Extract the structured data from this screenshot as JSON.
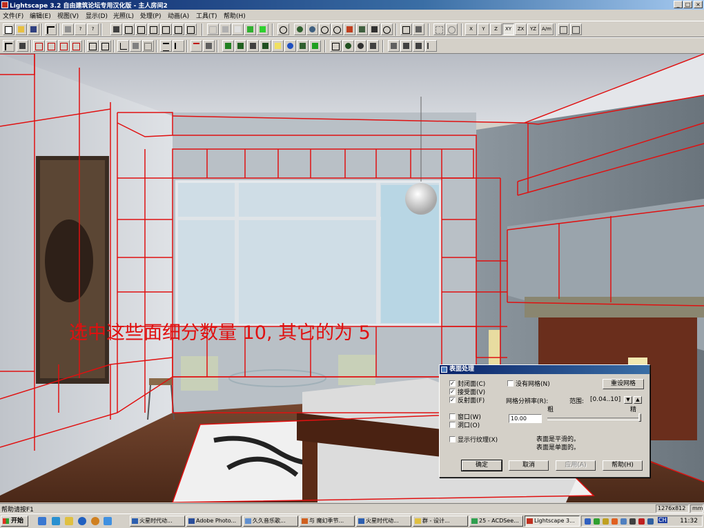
{
  "window": {
    "title": "Lightscape 3.2 自由建筑论坛专用汉化版 - 主人房间2",
    "min": "_",
    "max": "□",
    "close": "×"
  },
  "menu": [
    "文件(F)",
    "编辑(E)",
    "视图(V)",
    "显示(D)",
    "光照(L)",
    "处理(P)",
    "动画(A)",
    "工具(T)",
    "帮助(H)"
  ],
  "toolbar_row1": {
    "axis_buttons": [
      "X",
      "Y",
      "Z",
      "XY",
      "ZX",
      "YZ",
      "A/m"
    ]
  },
  "viewport": {
    "annotation": "选中这些面细分数量 10, 其它的为 5",
    "annotation_color": "#e01010",
    "outline_color": "#e01010"
  },
  "dialog": {
    "title": "表面处理",
    "checkboxes": [
      {
        "label": "封闭面(C)",
        "checked": true
      },
      {
        "label": "接受面(V)",
        "checked": true
      },
      {
        "label": "反射面(F)",
        "checked": true
      },
      {
        "label": "窗口(W)",
        "checked": false
      },
      {
        "label": "洞口(O)",
        "checked": false
      },
      {
        "label": "显示行纹理(X)",
        "checked": false
      },
      {
        "label": "没有网格(N)",
        "checked": false
      }
    ],
    "reset_mesh_button": "重设网格",
    "mesh_resolution_label": "网格分辨率(R):",
    "range_label": "范围:",
    "range_value": "[0.04..10]",
    "coarse_label": "粗",
    "fine_label": "精",
    "resolution_value": "10.00",
    "info_line1": "表面是平滑的。",
    "info_line2": "表面是单面的。",
    "buttons": {
      "ok": "确定",
      "cancel": "取消",
      "apply": "应用(A)",
      "help": "帮助(H)"
    }
  },
  "status": {
    "hint": "帮助请按F1",
    "resolution": "1276x812",
    "unit": "mm"
  },
  "taskbar": {
    "start": "开始",
    "tasks": [
      "火星时代动...",
      "Adobe Photo...",
      "久久音乐歌...",
      "与 魔幻季节...",
      "火星时代动...",
      "群 - 设计...",
      "25 - ACDSee...",
      "Lightscape 3..."
    ],
    "active_task": 7,
    "clock": "11:32",
    "tray_label": "CH"
  }
}
